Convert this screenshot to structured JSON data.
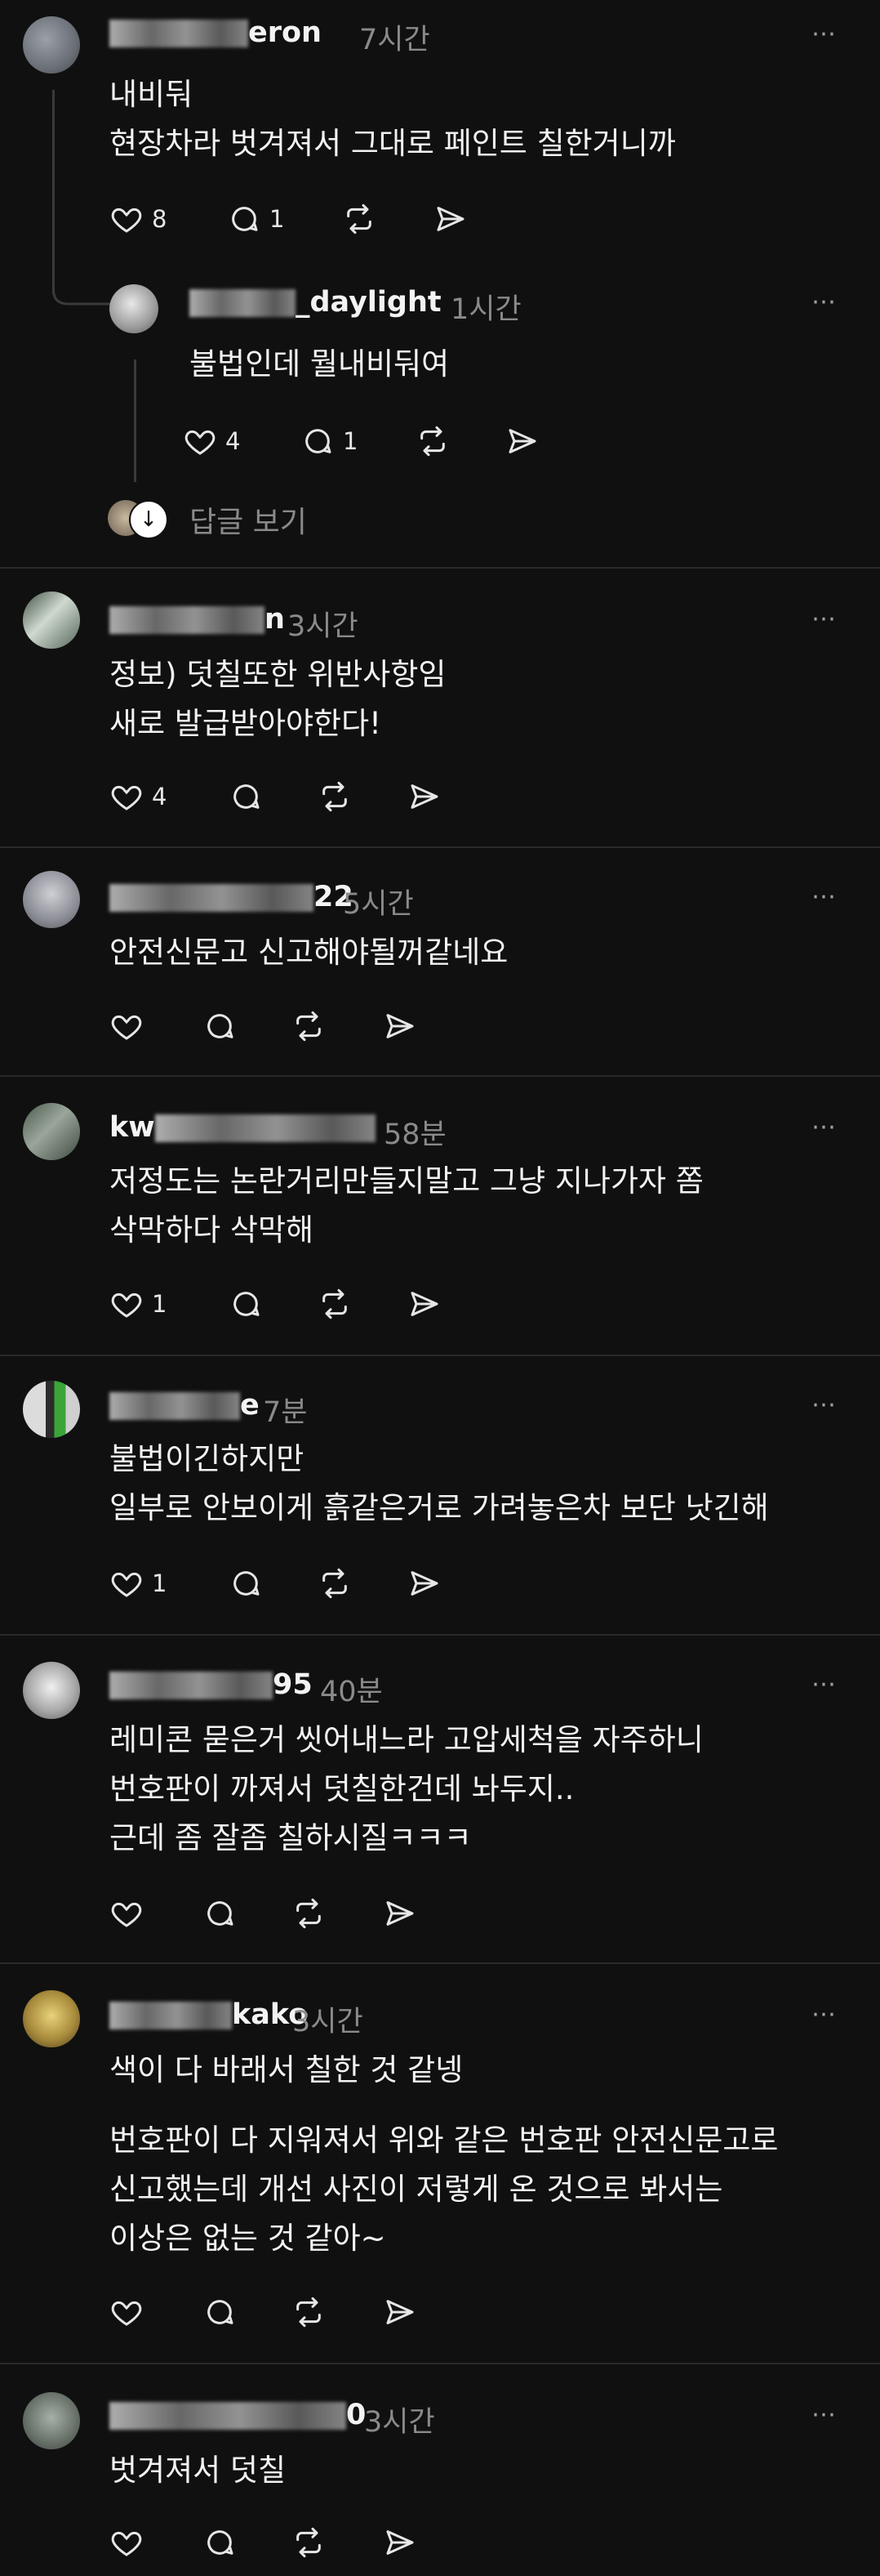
{
  "posts": [
    {
      "username_visible": "eron",
      "time": "7시간",
      "lines": [
        "내비둬",
        "현장차라 벗겨져서 그대로 페인트 칠한거니까"
      ],
      "likes": "8",
      "comments": "1"
    },
    {
      "username_visible": "_daylight",
      "time": "1시간",
      "lines": [
        "불법인데 뭘내비둬여"
      ],
      "likes": "4",
      "comments": "1"
    },
    {
      "username_visible": "n",
      "time": "3시간",
      "lines": [
        "정보) 덧칠또한 위반사항임",
        "새로 발급받아야한다!"
      ],
      "likes": "4",
      "comments": ""
    },
    {
      "username_visible": "22",
      "time": "5시간",
      "lines": [
        "안전신문고 신고해야될꺼같네요"
      ],
      "likes": "",
      "comments": ""
    },
    {
      "username_visible": "kw",
      "time": "58분",
      "lines": [
        "저정도는 논란거리만들지말고 그냥 지나가자 쫌",
        "삭막하다 삭막해"
      ],
      "likes": "1",
      "comments": ""
    },
    {
      "username_visible": "e",
      "time": "7분",
      "lines": [
        "불법이긴하지만",
        "일부로 안보이게 흙같은거로 가려놓은차 보단 낫긴해"
      ],
      "likes": "1",
      "comments": ""
    },
    {
      "username_visible": "95",
      "time": "40분",
      "lines": [
        "레미콘 묻은거 씻어내느라 고압세척을 자주하니",
        "번호판이 까져서 덧칠한건데 놔두지..",
        "근데 좀 잘좀 칠하시질ㅋㅋㅋ"
      ],
      "likes": "",
      "comments": ""
    },
    {
      "username_visible": "kako",
      "time": "3시간",
      "lines": [
        "색이 다 바래서 칠한 것 같넹",
        "",
        "번호판이 다 지워져서 위와 같은 번호판 안전신문고로",
        "신고했는데 개선 사진이 저렇게 온 것으로 봐서는",
        "이상은 없는 것 같아~"
      ],
      "likes": "",
      "comments": ""
    },
    {
      "username_visible": "0",
      "time": "3시간",
      "lines": [
        "벗겨져서 덧칠"
      ],
      "likes": "",
      "comments": ""
    }
  ],
  "view_replies_label": "답글 보기",
  "more_icon": "⋯",
  "colors": {
    "background": "#101010",
    "text": "#f3f3f3",
    "muted": "#8a8a8a",
    "divider": "#2a2a2a"
  }
}
